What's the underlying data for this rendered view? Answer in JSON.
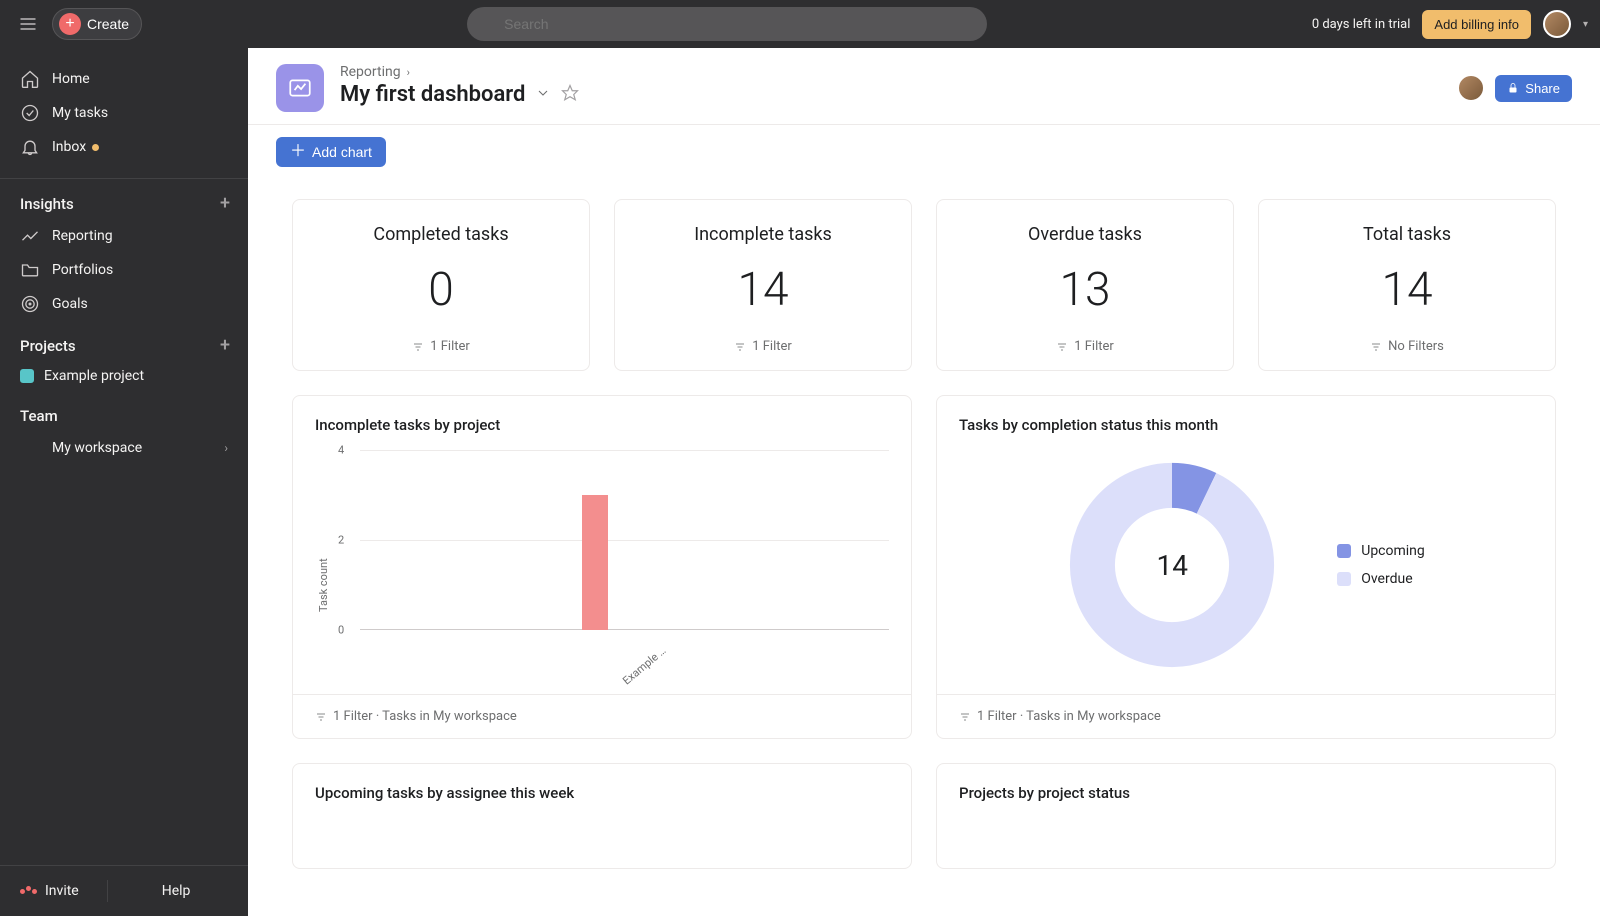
{
  "topbar": {
    "create_label": "Create",
    "search_placeholder": "Search",
    "trial_text": "0 days left in trial",
    "billing_label": "Add billing info"
  },
  "sidebar": {
    "home": "Home",
    "my_tasks": "My tasks",
    "inbox": "Inbox",
    "insights_header": "Insights",
    "reporting": "Reporting",
    "portfolios": "Portfolios",
    "goals": "Goals",
    "projects_header": "Projects",
    "example_project": "Example project",
    "team_header": "Team",
    "my_workspace": "My workspace",
    "invite": "Invite",
    "help": "Help"
  },
  "header": {
    "breadcrumb_reporting": "Reporting",
    "title": "My first dashboard",
    "share_label": "Share"
  },
  "toolbar": {
    "add_chart_label": "Add chart"
  },
  "stats": [
    {
      "title": "Completed tasks",
      "value": "0",
      "filter": "1 Filter"
    },
    {
      "title": "Incomplete tasks",
      "value": "14",
      "filter": "1 Filter"
    },
    {
      "title": "Overdue tasks",
      "value": "13",
      "filter": "1 Filter"
    },
    {
      "title": "Total tasks",
      "value": "14",
      "filter": "No Filters"
    }
  ],
  "bar_chart": {
    "title": "Incomplete tasks by project",
    "footer": "1 Filter · Tasks in My workspace"
  },
  "donut_chart": {
    "title": "Tasks by completion status this month",
    "center_value": "14",
    "legend": [
      {
        "label": "Upcoming",
        "color": "#8494e4"
      },
      {
        "label": "Overdue",
        "color": "#dcdffa"
      }
    ],
    "footer": "1 Filter · Tasks in My workspace"
  },
  "lower_cards": {
    "left_title": "Upcoming tasks by assignee this week",
    "right_title": "Projects by project status"
  },
  "chart_data": [
    {
      "type": "bar",
      "title": "Incomplete tasks by project",
      "ylabel": "Task count",
      "ylim": [
        0,
        4
      ],
      "categories": [
        "Example …"
      ],
      "values": [
        3
      ]
    },
    {
      "type": "pie",
      "title": "Tasks by completion status this month",
      "series": [
        {
          "name": "Upcoming",
          "value": 1
        },
        {
          "name": "Overdue",
          "value": 13
        }
      ],
      "total": 14
    }
  ]
}
